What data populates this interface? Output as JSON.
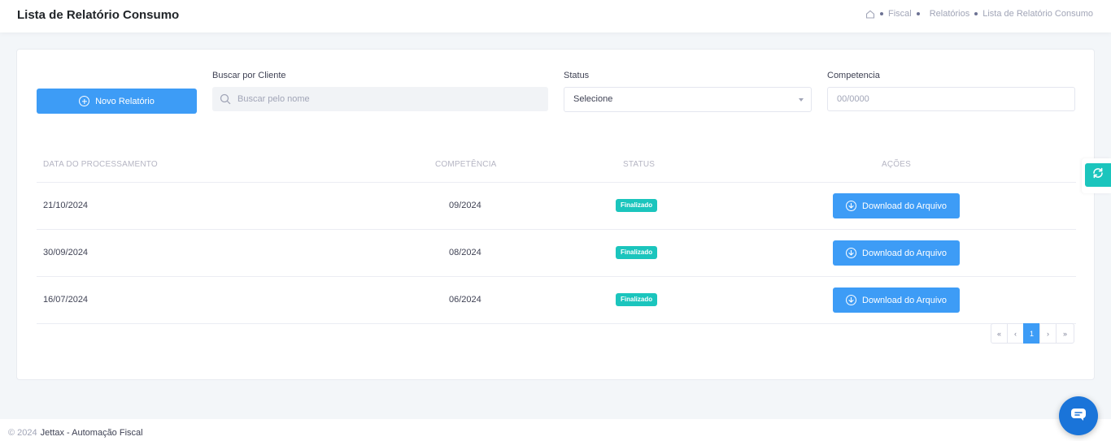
{
  "header": {
    "title": "Lista de Relatório Consumo",
    "breadcrumb": [
      "Fiscal",
      "Relatórios",
      "Lista de Relatório Consumo"
    ]
  },
  "toolbar": {
    "new_report_label": "Novo Relatório"
  },
  "filters": {
    "client_label": "Buscar por Cliente",
    "client_placeholder": "Buscar pelo nome",
    "status_label": "Status",
    "status_value": "Selecione",
    "competencia_label": "Competencia",
    "competencia_placeholder": "00/0000"
  },
  "table": {
    "columns": [
      "DATA DO PROCESSAMENTO",
      "COMPETÊNCIA",
      "STATUS",
      "AÇÕES"
    ],
    "rows": [
      {
        "date": "21/10/2024",
        "competencia": "09/2024",
        "status": "Finalizado",
        "action": "Download do Arquivo"
      },
      {
        "date": "30/09/2024",
        "competencia": "08/2024",
        "status": "Finalizado",
        "action": "Download do Arquivo"
      },
      {
        "date": "16/07/2024",
        "competencia": "06/2024",
        "status": "Finalizado",
        "action": "Download do Arquivo"
      }
    ]
  },
  "pagination": {
    "first": "«",
    "prev": "‹",
    "current": "1",
    "next": "›",
    "last": "»"
  },
  "footer": {
    "copyright": "© 2024",
    "brand": "Jettax - Automação Fiscal"
  },
  "colors": {
    "primary": "#3d9cf6",
    "success": "#1bc5bd",
    "chat": "#1a74d9"
  },
  "icons": {
    "home": "home-icon",
    "new": "plus-circle-icon",
    "search": "search-icon",
    "download": "download-circle-icon",
    "side": "refresh-icon",
    "chat": "chat-icon"
  }
}
